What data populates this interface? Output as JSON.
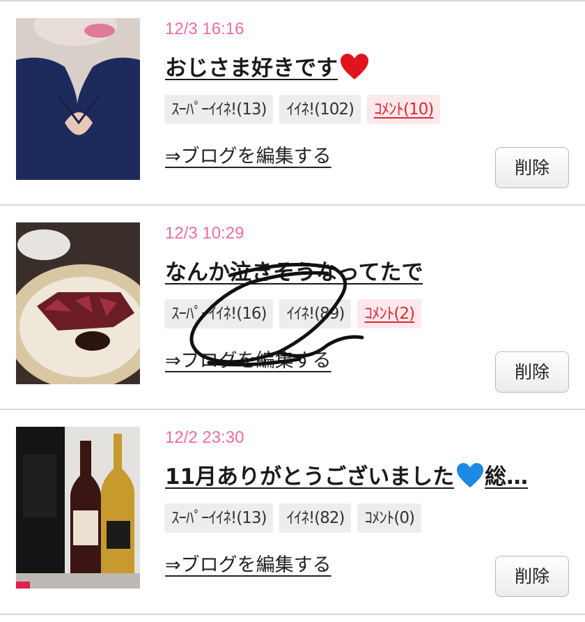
{
  "posts": [
    {
      "date": "12/3 16:16",
      "title": "おじさま好きです",
      "title_emoji": "red-heart-icon",
      "tags": {
        "super_like": "ｽｰﾊﾟｰｲｲﾈ!(13)",
        "like": "ｲｲﾈ!(102)",
        "comment": "ｺﾒﾝﾄ(10)"
      },
      "comment_active": true,
      "edit_link": "⇒ブログを編集する",
      "delete_label": "削除",
      "thumbnail": "woman-in-navy-dress-photo"
    },
    {
      "date": "12/3 10:29",
      "title": "なんか泣きそうなってたで",
      "tags": {
        "super_like": "ｽｰﾊﾟｰｲｲﾈ!(16)",
        "like": "ｲｲﾈ!(89)",
        "comment": "ｺﾒﾝﾄ(2)"
      },
      "comment_active": true,
      "edit_link": "⇒ブログを編集する",
      "delete_label": "削除",
      "thumbnail": "steak-dinner-photo"
    },
    {
      "date": "12/2 23:30",
      "title": "11月ありがとうございました",
      "title_emoji": "blue-heart-icon",
      "title_suffix": "総…",
      "tags": {
        "super_like": "ｽｰﾊﾟｰｲｲﾈ!(13)",
        "like": "ｲｲﾈ!(82)",
        "comment": "ｺﾒﾝﾄ(0)"
      },
      "comment_active": false,
      "edit_link": "⇒ブログを編集する",
      "delete_label": "削除",
      "thumbnail": "wine-bottles-photo"
    }
  ],
  "colors": {
    "date_pink": "#f06aa8",
    "comment_red": "#e0262f",
    "tag_bg": "#ededed"
  }
}
